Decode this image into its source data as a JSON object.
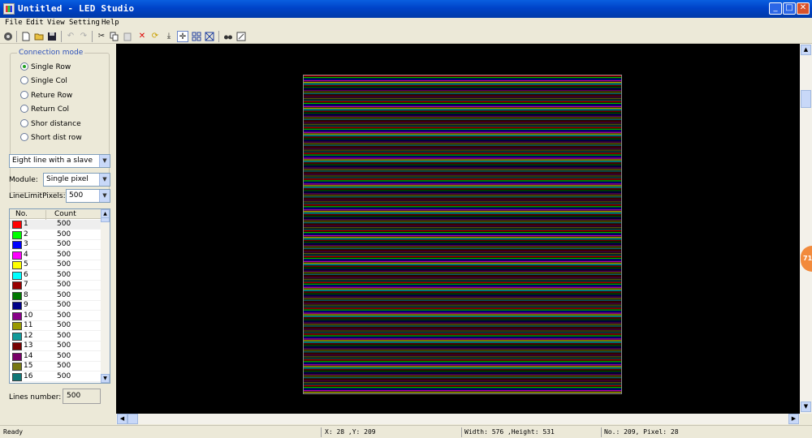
{
  "window": {
    "title": "Untitled - LED Studio",
    "buttons": {
      "minimize": "_",
      "maximize": "□",
      "close": "✕"
    }
  },
  "menu": [
    "File",
    "Edit",
    "View",
    "Setting",
    "Help"
  ],
  "toolbar": {
    "icons": [
      "home-icon",
      "new-file-icon",
      "open-folder-icon",
      "save-icon",
      "undo-icon",
      "redo-icon",
      "cut-icon",
      "copy-icon",
      "paste-icon",
      "delete-icon",
      "rotate-icon",
      "move-down-icon",
      "crosshair-icon",
      "grid-icon",
      "select-box-icon",
      "find-icon",
      "export-icon"
    ]
  },
  "connection_mode": {
    "label": "Connection mode",
    "options": [
      "Single Row",
      "Single Col",
      "Reture Row",
      "Return Col",
      "Shor distance",
      "Short dist row"
    ],
    "selected": "Single Row"
  },
  "mode_select": {
    "value": "Eight line with a slave"
  },
  "module": {
    "label": "Module:",
    "value": "Single pixel"
  },
  "line_limit": {
    "label": "LineLimitPixels:",
    "value": "500"
  },
  "lines_table": {
    "headers": [
      "No.",
      "Count"
    ],
    "rows": [
      {
        "no": "1",
        "count": "500",
        "color": "#ff0000"
      },
      {
        "no": "2",
        "count": "500",
        "color": "#00ff00"
      },
      {
        "no": "3",
        "count": "500",
        "color": "#0000ff"
      },
      {
        "no": "4",
        "count": "500",
        "color": "#ff00ff"
      },
      {
        "no": "5",
        "count": "500",
        "color": "#ffff00"
      },
      {
        "no": "6",
        "count": "500",
        "color": "#00ffff"
      },
      {
        "no": "7",
        "count": "500",
        "color": "#990000"
      },
      {
        "no": "8",
        "count": "500",
        "color": "#007700"
      },
      {
        "no": "9",
        "count": "500",
        "color": "#000088"
      },
      {
        "no": "10",
        "count": "500",
        "color": "#880088"
      },
      {
        "no": "11",
        "count": "500",
        "color": "#999900"
      },
      {
        "no": "12",
        "count": "500",
        "color": "#119999"
      },
      {
        "no": "13",
        "count": "500",
        "color": "#770000"
      },
      {
        "no": "14",
        "count": "500",
        "color": "#770066"
      },
      {
        "no": "15",
        "count": "500",
        "color": "#777711"
      },
      {
        "no": "16",
        "count": "500",
        "color": "#117777"
      }
    ]
  },
  "lines_number": {
    "label": "Lines number:",
    "value": "500"
  },
  "status": {
    "ready": "Ready",
    "coords": "X: 28 ,Y: 209",
    "size": "Width: 576 ,Height: 531",
    "pixel": "No.: 209, Pixel: 28"
  },
  "badge": {
    "text": "71"
  }
}
